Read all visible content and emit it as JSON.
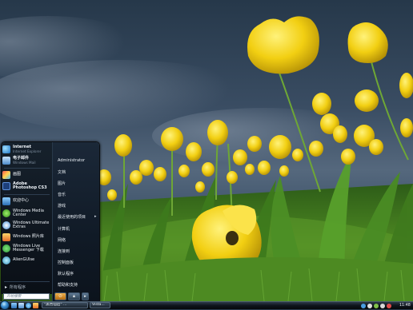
{
  "start_menu": {
    "pinned": [
      {
        "title": "Internet",
        "sub": "Internet Explorer",
        "icon": "globe-icon"
      },
      {
        "title": "电子邮件",
        "sub": "Windows Mail",
        "icon": "mail-icon"
      }
    ],
    "recent": [
      {
        "title": "画图",
        "icon": "paint-icon"
      },
      {
        "title": "Adobe Photoshop CS3",
        "icon": "photoshop-icon",
        "bold": true
      },
      {
        "title": "欢迎中心",
        "icon": "welcome-center-icon"
      },
      {
        "title": "Windows Media Center",
        "icon": "media-center-icon"
      },
      {
        "title": "Windows Ultimate Extras",
        "icon": "ultimate-extras-icon"
      },
      {
        "title": "Windows 照片库",
        "icon": "photo-gallery-icon"
      },
      {
        "title": "Windows Live Messenger 下载",
        "icon": "messenger-icon"
      },
      {
        "title": "AlienGUIse",
        "icon": "alienguise-icon"
      }
    ],
    "all_programs_label": "所有程序",
    "search_placeholder": "开始搜索",
    "right_items": [
      {
        "label": "Administrator"
      },
      {
        "label": "文档"
      },
      {
        "label": "图片"
      },
      {
        "label": "音乐"
      },
      {
        "label": "游戏"
      },
      {
        "label": "最近使用的项目",
        "has_submenu": true
      },
      {
        "label": "计算机"
      },
      {
        "label": "网络"
      },
      {
        "label": "连接到"
      },
      {
        "label": "控制面板"
      },
      {
        "label": "默认程序"
      },
      {
        "label": "帮助和支持"
      }
    ]
  },
  "taskbar": {
    "buttons": [
      {
        "label": "\"黑色仙后\" ..."
      },
      {
        "label": "Vista..."
      }
    ],
    "clock": "11:48"
  },
  "colors": {
    "sky_top": "#2c3e52",
    "tulip_yellow": "#f2d21a",
    "grass_green": "#3f7a1d"
  }
}
